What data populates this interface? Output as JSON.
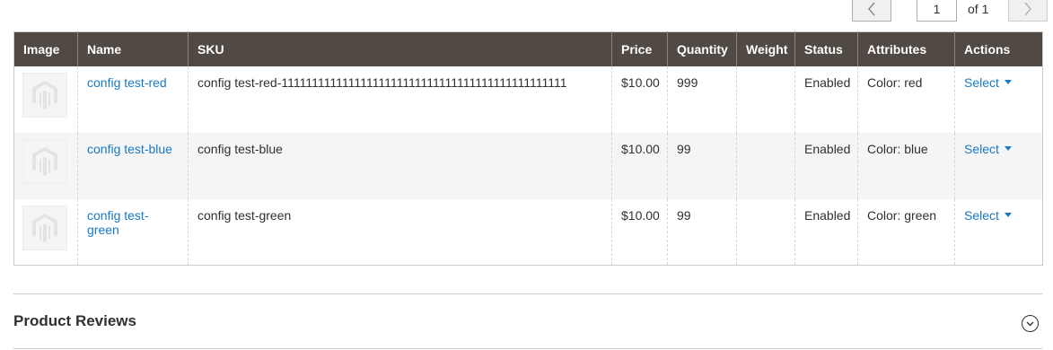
{
  "pager": {
    "prev_icon": "chevron-left-icon",
    "current_page": "1",
    "of_label": "of 1",
    "next_icon": "chevron-right-icon"
  },
  "table": {
    "columns": [
      "Image",
      "Name",
      "SKU",
      "Price",
      "Quantity",
      "Weight",
      "Status",
      "Attributes",
      "Actions"
    ],
    "rows": [
      {
        "name": "config test-red",
        "sku": "config test-red-11111111111111111111111111111111111111111111111",
        "price": "$10.00",
        "quantity": "999",
        "weight": "",
        "status": "Enabled",
        "attributes": "Color: red",
        "action": "Select"
      },
      {
        "name": "config test-blue",
        "sku": "config test-blue",
        "price": "$10.00",
        "quantity": "99",
        "weight": "",
        "status": "Enabled",
        "attributes": "Color: blue",
        "action": "Select"
      },
      {
        "name": "config test-green",
        "sku": "config test-green",
        "price": "$10.00",
        "quantity": "99",
        "weight": "",
        "status": "Enabled",
        "attributes": "Color: green",
        "action": "Select"
      }
    ]
  },
  "section": {
    "title": "Product Reviews",
    "toggle_icon": "chevron-down-circle-icon"
  },
  "colors": {
    "header_bg": "#514943",
    "link": "#1979c3",
    "alt_row": "#f5f5f5"
  }
}
